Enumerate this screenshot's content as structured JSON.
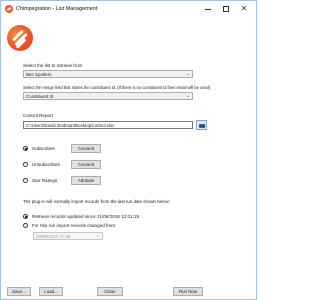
{
  "window": {
    "title": "Chimpegration - List Management",
    "minimize_glyph": "",
    "maximize_glyph": "",
    "close_glyph": "✕"
  },
  "list_section": {
    "label": "Select the list to retrieve from",
    "selected": "Bee Spotters"
  },
  "merge_section": {
    "label": "Select the merge field that stores the constituent id. (If there is no constituent id then email will be used)",
    "selected": "Constituent Id"
  },
  "control_report": {
    "label": "Control Report",
    "path": "C:\\Users\\David Zeidman\\Desktop\\control.xlsx"
  },
  "options": [
    {
      "label": "Subscribes",
      "button": "Consent",
      "checked": true
    },
    {
      "label": "Unsubscribes",
      "button": "Consent",
      "checked": false
    },
    {
      "label": "Star Ratings",
      "button": "Attribute",
      "checked": false
    }
  ],
  "import_note": "The plug-in will normally import records from the last run date shown below:",
  "retrieve": {
    "since_label": "Retrieve records updated since 21/06/2018 12:01:15",
    "this_run_label": "For this run import records changed from:",
    "since_checked": true,
    "date_value": "22/06/2018 17:15"
  },
  "footer": {
    "save": "Save...",
    "load": "Load...",
    "close": "Close",
    "run": "Run Now"
  },
  "colors": {
    "logo": "#e4532a",
    "window_border": "#a9c2dc"
  }
}
